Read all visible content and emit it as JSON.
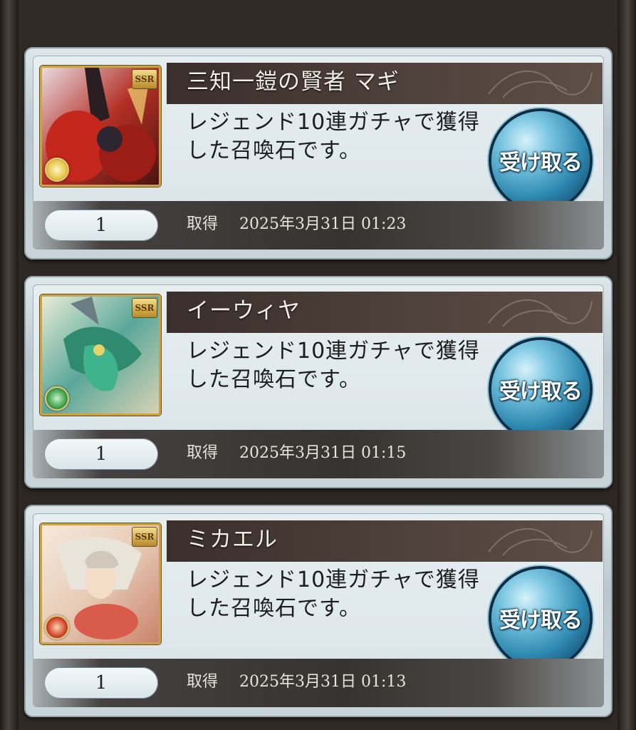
{
  "items": [
    {
      "name": "三知一鎧の賢者 マギ",
      "rarity": "SSR",
      "description": "レジェンド10連ガチャで獲得した召喚石です。",
      "button_label": "受け取る",
      "quantity": "1",
      "acquired_label": "取得",
      "acquired_date": "2025年3月31日 01:23",
      "element": "light",
      "element_color": "#e8c54a"
    },
    {
      "name": "イーウィヤ",
      "rarity": "SSR",
      "description": "レジェンド10連ガチャで獲得した召喚石です。",
      "button_label": "受け取る",
      "quantity": "1",
      "acquired_label": "取得",
      "acquired_date": "2025年3月31日 01:15",
      "element": "wind",
      "element_color": "#3ea04a"
    },
    {
      "name": "ミカエル",
      "rarity": "SSR",
      "description": "レジェンド10連ガチャで獲得した召喚石です。",
      "button_label": "受け取る",
      "quantity": "1",
      "acquired_label": "取得",
      "acquired_date": "2025年3月31日 01:13",
      "element": "fire",
      "element_color": "#d0452a"
    }
  ]
}
